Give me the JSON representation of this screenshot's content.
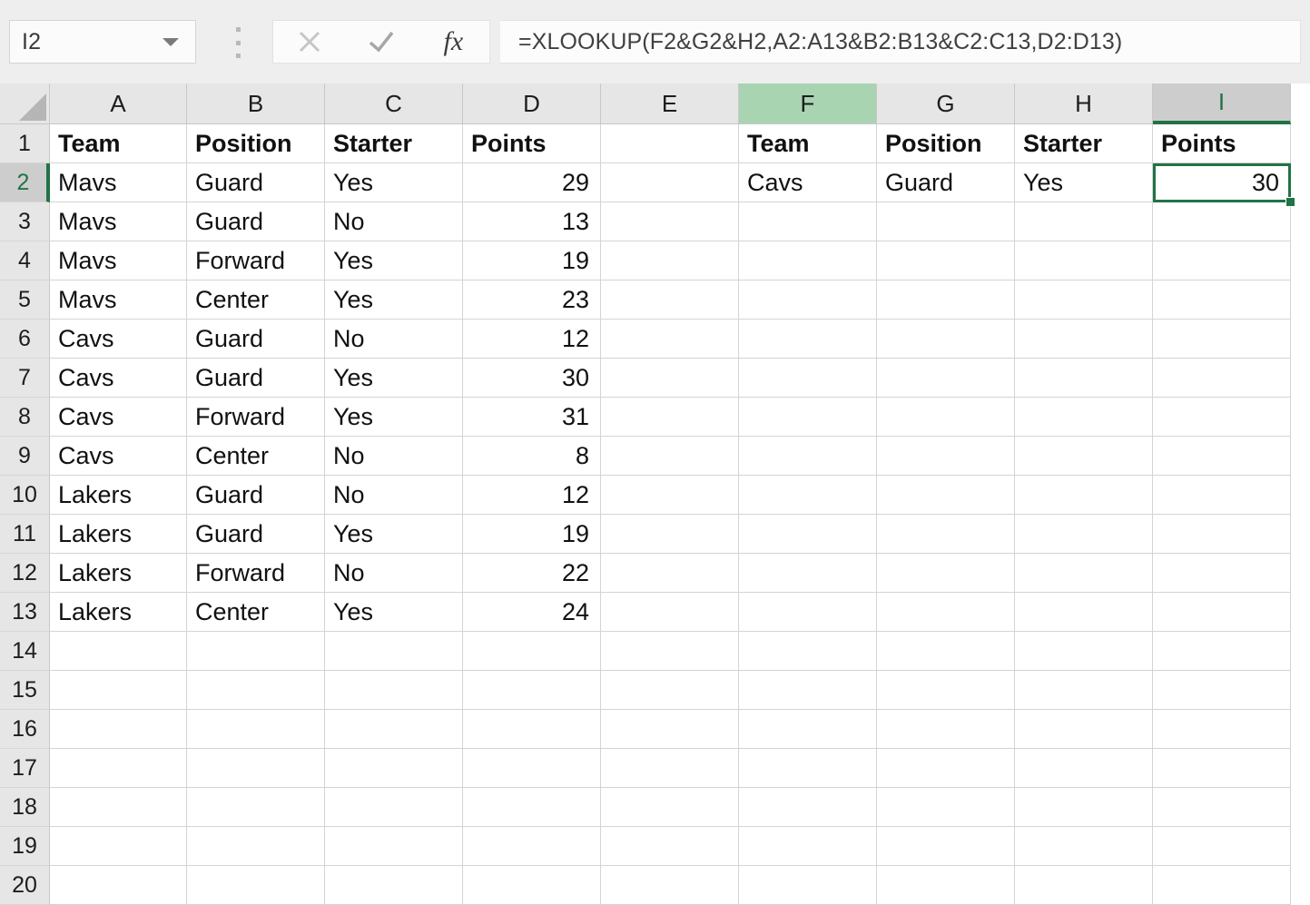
{
  "app": {
    "name_box_value": "I2",
    "formula": "=XLOOKUP(F2&G2&H2,A2:A13&B2:B13&C2:C13,D2:D13)",
    "cancel_icon": "close-icon",
    "enter_icon": "check-icon",
    "insert_function_icon": "fx-icon",
    "insert_function_label": "fx",
    "accent_color": "#217346",
    "highlight_color": "#a9d4b2"
  },
  "grid": {
    "column_headers": [
      "A",
      "B",
      "C",
      "D",
      "E",
      "F",
      "G",
      "H",
      "I"
    ],
    "row_headers": [
      "1",
      "2",
      "3",
      "4",
      "5",
      "6",
      "7",
      "8",
      "9",
      "10",
      "11",
      "12",
      "13",
      "14",
      "15",
      "16",
      "17",
      "18",
      "19",
      "20"
    ],
    "selected_column": "I",
    "selected_row": "2",
    "active_cell": "I2",
    "highlighted_column": "F"
  },
  "source_table": {
    "headers": [
      "Team",
      "Position",
      "Starter",
      "Points"
    ],
    "rows": [
      [
        "Mavs",
        "Guard",
        "Yes",
        "29"
      ],
      [
        "Mavs",
        "Guard",
        "No",
        "13"
      ],
      [
        "Mavs",
        "Forward",
        "Yes",
        "19"
      ],
      [
        "Mavs",
        "Center",
        "Yes",
        "23"
      ],
      [
        "Cavs",
        "Guard",
        "No",
        "12"
      ],
      [
        "Cavs",
        "Guard",
        "Yes",
        "30"
      ],
      [
        "Cavs",
        "Forward",
        "Yes",
        "31"
      ],
      [
        "Cavs",
        "Center",
        "No",
        "8"
      ],
      [
        "Lakers",
        "Guard",
        "No",
        "12"
      ],
      [
        "Lakers",
        "Guard",
        "Yes",
        "19"
      ],
      [
        "Lakers",
        "Forward",
        "No",
        "22"
      ],
      [
        "Lakers",
        "Center",
        "Yes",
        "24"
      ]
    ]
  },
  "lookup_table": {
    "headers": [
      "Team",
      "Position",
      "Starter",
      "Points"
    ],
    "rows": [
      [
        "Cavs",
        "Guard",
        "Yes",
        "30"
      ]
    ]
  }
}
